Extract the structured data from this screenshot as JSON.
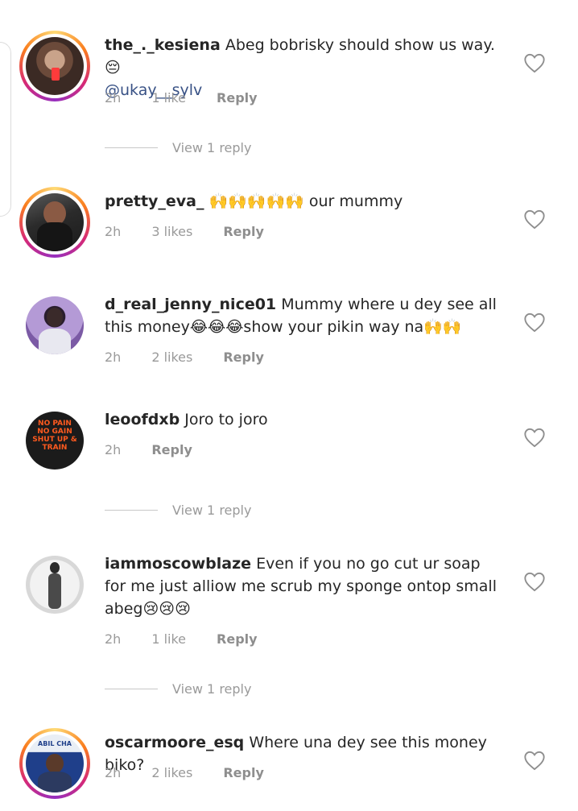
{
  "comments": [
    {
      "username": "the_._kesiena",
      "text": "Abeg bobrisky should show us way. 😔",
      "mention": "@ukay__sylv",
      "time": "2h",
      "likes": "1 like",
      "reply": "Reply",
      "view_replies": "View 1 reply"
    },
    {
      "username": "pretty_eva_",
      "text": "🙌🙌🙌🙌🙌 our mummy",
      "time": "2h",
      "likes": "3 likes",
      "reply": "Reply"
    },
    {
      "username": "d_real_jenny_nice01",
      "text": "Mummy where u dey see all this money😂😂😂show your pikin way na🙌🙌",
      "time": "2h",
      "likes": "2 likes",
      "reply": "Reply"
    },
    {
      "username": "leoofdxb",
      "text": "Joro to joro",
      "time": "2h",
      "reply": "Reply",
      "view_replies": "View 1 reply"
    },
    {
      "username": "iammoscowblaze",
      "text": "Even if you no go cut ur soap for me just alliow me scrub my sponge ontop small abeg😢😢😢",
      "time": "2h",
      "likes": "1 like",
      "reply": "Reply",
      "view_replies": "View 1 reply"
    },
    {
      "username": "oscarmoore_esq",
      "text": "Where una dey see this money biko?",
      "time": "2h",
      "likes": "2 likes",
      "reply": "Reply"
    }
  ],
  "avatar_shirt_text": "NO PAIN NO GAIN SHUT UP & TRAIN",
  "avatar_badge_text": "ABIL CHA",
  "icons": {
    "heart": "heart-outline-icon"
  },
  "colors": {
    "mention": "#385185",
    "meta": "#9a9a9a",
    "story_ring": "#d62976"
  }
}
